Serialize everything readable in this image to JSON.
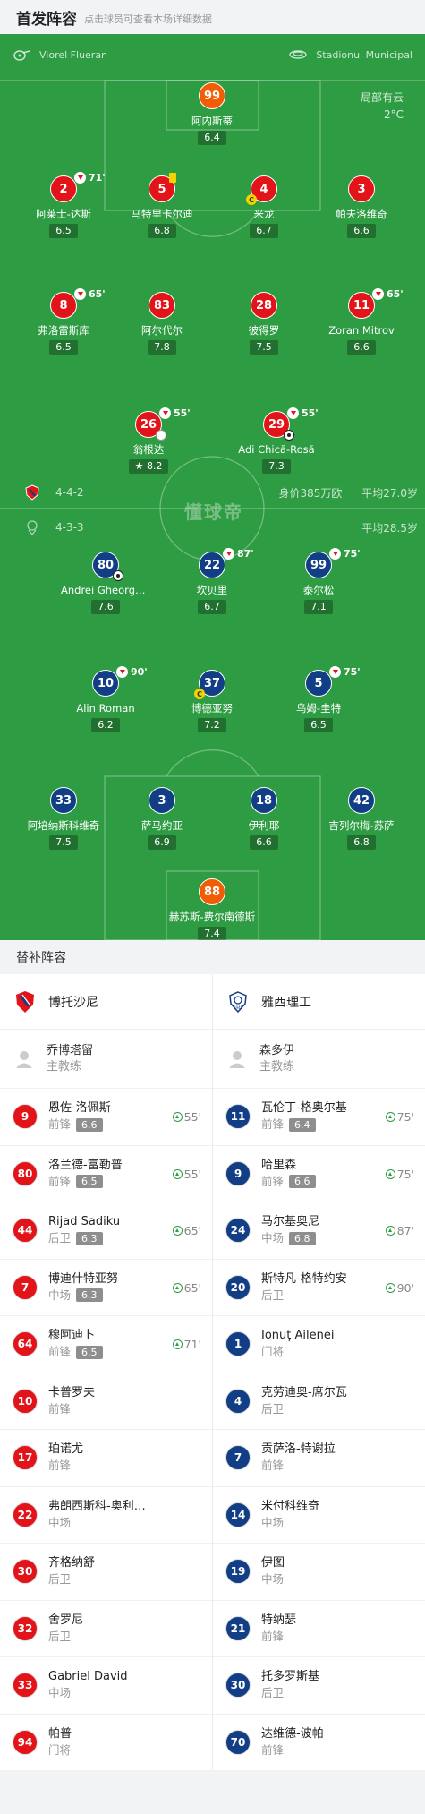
{
  "header": {
    "title": "首发阵容",
    "subtitle": "点击球员可查看本场详细数据"
  },
  "pitch": {
    "referee": "Viorel Flueran",
    "stadium": "Stadionul Municipal",
    "weather": "局部有云",
    "temperature": "2°C",
    "home": {
      "formation": "4-4-2",
      "value": "身价385万欧",
      "avg_age": "平均27.0岁"
    },
    "away": {
      "formation": "4-3-3",
      "avg_age": "平均28.5岁"
    },
    "brand": "懂球帝"
  },
  "home_players": [
    {
      "num": "99",
      "name": "阿内斯蒂",
      "rating": "6.4"
    },
    {
      "num": "2",
      "name": "阿莱士-达斯",
      "rating": "6.5",
      "sub": "71'"
    },
    {
      "num": "5",
      "name": "马特里卡尔迪",
      "rating": "6.8"
    },
    {
      "num": "4",
      "name": "米龙",
      "rating": "6.7"
    },
    {
      "num": "3",
      "name": "帕夫洛维奇",
      "rating": "6.6"
    },
    {
      "num": "8",
      "name": "弗洛雷斯库",
      "rating": "6.5",
      "sub": "65'"
    },
    {
      "num": "83",
      "name": "阿尔代尔",
      "rating": "7.8"
    },
    {
      "num": "28",
      "name": "彼得罗",
      "rating": "7.5"
    },
    {
      "num": "11",
      "name": "Zoran Mitrov",
      "rating": "6.6",
      "sub": "65'"
    },
    {
      "num": "26",
      "name": "翁根达",
      "rating": "8.2",
      "sub": "55'"
    },
    {
      "num": "29",
      "name": "Adi Chică-Rosă",
      "rating": "7.3",
      "sub": "55'"
    }
  ],
  "away_players": [
    {
      "num": "80",
      "name": "Andrei Gheorghiță",
      "rating": "7.6"
    },
    {
      "num": "22",
      "name": "坎贝里",
      "rating": "6.7",
      "sub": "87'"
    },
    {
      "num": "99",
      "name": "泰尔松",
      "rating": "7.1",
      "sub": "75'"
    },
    {
      "num": "10",
      "name": "Alin Roman",
      "rating": "6.2",
      "sub": "90'"
    },
    {
      "num": "37",
      "name": "博德亚努",
      "rating": "7.2"
    },
    {
      "num": "5",
      "name": "乌姆-圭特",
      "rating": "6.5",
      "sub": "75'"
    },
    {
      "num": "33",
      "name": "阿培纳斯科维奇",
      "rating": "7.5"
    },
    {
      "num": "3",
      "name": "萨马约亚",
      "rating": "6.9"
    },
    {
      "num": "18",
      "name": "伊利耶",
      "rating": "6.6"
    },
    {
      "num": "42",
      "name": "吉列尔梅-苏萨",
      "rating": "6.8"
    },
    {
      "num": "88",
      "name": "赫苏斯-费尔南德斯",
      "rating": "7.4"
    }
  ],
  "subs": {
    "title": "替补阵容",
    "home": {
      "team": "博托沙尼",
      "coach": {
        "name": "乔博塔留",
        "role": "主教练"
      },
      "list": [
        {
          "num": "9",
          "name": "恩佐-洛佩斯",
          "pos": "前锋",
          "rating": "6.6",
          "time": "55'"
        },
        {
          "num": "80",
          "name": "洛兰德-富勒普",
          "pos": "前锋",
          "rating": "6.5",
          "time": "55'"
        },
        {
          "num": "44",
          "name": "Rijad Sadiku",
          "pos": "后卫",
          "rating": "6.3",
          "time": "65'"
        },
        {
          "num": "7",
          "name": "博迪什特亚努",
          "pos": "中场",
          "rating": "6.3",
          "time": "65'"
        },
        {
          "num": "64",
          "name": "穆阿迪卜",
          "pos": "前锋",
          "rating": "6.5",
          "time": "71'"
        },
        {
          "num": "10",
          "name": "卡普罗夫",
          "pos": "前锋"
        },
        {
          "num": "17",
          "name": "珀诺尤",
          "pos": "前锋"
        },
        {
          "num": "22",
          "name": "弗朗西斯科-奥利维拉",
          "pos": "中场"
        },
        {
          "num": "30",
          "name": "齐格纳舒",
          "pos": "后卫"
        },
        {
          "num": "32",
          "name": "舍罗尼",
          "pos": "后卫"
        },
        {
          "num": "33",
          "name": "Gabriel David",
          "pos": "中场"
        },
        {
          "num": "94",
          "name": "帕普",
          "pos": "门将"
        }
      ]
    },
    "away": {
      "team": "雅西理工",
      "coach": {
        "name": "森多伊",
        "role": "主教练"
      },
      "list": [
        {
          "num": "11",
          "name": "瓦伦丁-格奥尔基",
          "pos": "前锋",
          "rating": "6.4",
          "time": "75'"
        },
        {
          "num": "9",
          "name": "哈里森",
          "pos": "前锋",
          "rating": "6.6",
          "time": "75'"
        },
        {
          "num": "24",
          "name": "马尔基奥尼",
          "pos": "中场",
          "rating": "6.8",
          "time": "87'"
        },
        {
          "num": "20",
          "name": "斯特凡-格特约安",
          "pos": "后卫",
          "time": "90'"
        },
        {
          "num": "1",
          "name": "Ionuț Ailenei",
          "pos": "门将"
        },
        {
          "num": "4",
          "name": "克劳迪奥-席尔瓦",
          "pos": "后卫"
        },
        {
          "num": "7",
          "name": "贡萨洛-特谢拉",
          "pos": "前锋"
        },
        {
          "num": "14",
          "name": "米付科维奇",
          "pos": "中场"
        },
        {
          "num": "19",
          "name": "伊图",
          "pos": "中场"
        },
        {
          "num": "21",
          "name": "特纳瑟",
          "pos": "前锋"
        },
        {
          "num": "30",
          "name": "托多罗斯基",
          "pos": "后卫"
        },
        {
          "num": "70",
          "name": "达维德-波帕",
          "pos": "前锋"
        }
      ]
    }
  },
  "colors": {
    "pitch": "#2e9c43",
    "home": "#e3131a",
    "away": "#123e86",
    "gk": "#f25c05"
  }
}
